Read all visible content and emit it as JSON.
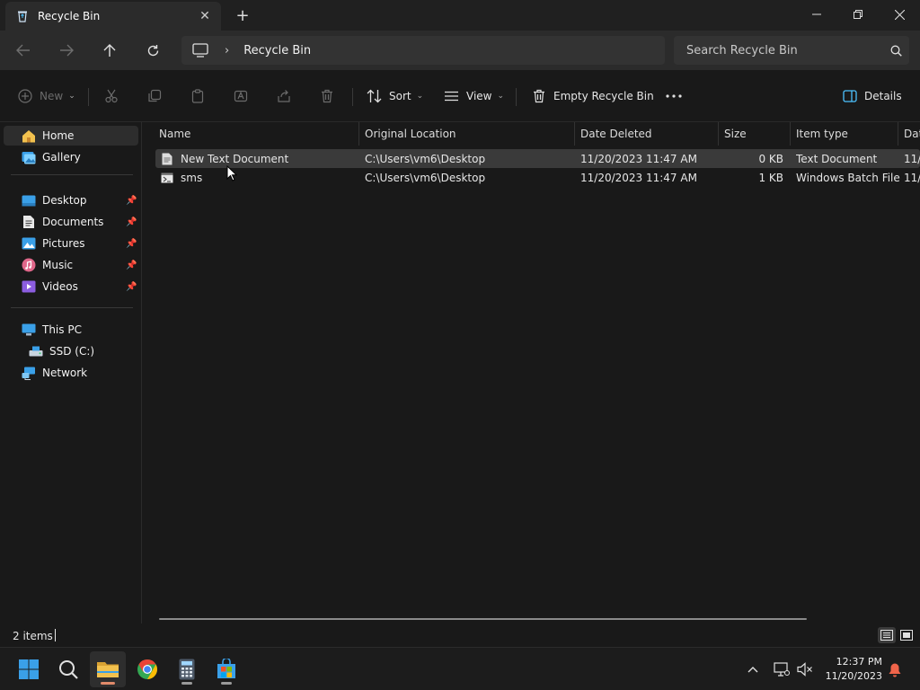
{
  "window": {
    "tab_title": "Recycle Bin",
    "close_tab": "✕",
    "new_tab": "+"
  },
  "address": {
    "crumbs": [
      "Recycle Bin"
    ],
    "search_placeholder": "Search Recycle Bin"
  },
  "toolbar": {
    "new_label": "New",
    "sort_label": "Sort",
    "view_label": "View",
    "empty_label": "Empty Recycle Bin",
    "details_label": "Details"
  },
  "sidebar": {
    "items": [
      {
        "label": "Home",
        "icon": "home-icon"
      },
      {
        "label": "Gallery",
        "icon": "gallery-icon"
      },
      {
        "label": "Desktop",
        "icon": "desktop-folder-icon"
      },
      {
        "label": "Documents",
        "icon": "documents-folder-icon"
      },
      {
        "label": "Pictures",
        "icon": "pictures-folder-icon"
      },
      {
        "label": "Music",
        "icon": "music-folder-icon"
      },
      {
        "label": "Videos",
        "icon": "videos-folder-icon"
      },
      {
        "label": "This PC",
        "icon": "this-pc-icon"
      },
      {
        "label": "SSD (C:)",
        "icon": "drive-icon"
      },
      {
        "label": "Network",
        "icon": "network-icon"
      }
    ]
  },
  "table": {
    "columns": [
      "Name",
      "Original Location",
      "Date Deleted",
      "Size",
      "Item type",
      "Dat"
    ],
    "rows": [
      {
        "name": "New Text Document",
        "location": "C:\\Users\\vm6\\Desktop",
        "date": "11/20/2023 11:47 AM",
        "size": "0 KB",
        "type": "Text Document",
        "extra": "11/"
      },
      {
        "name": "sms",
        "location": "C:\\Users\\vm6\\Desktop",
        "date": "11/20/2023 11:47 AM",
        "size": "1 KB",
        "type": "Windows Batch File",
        "extra": "11/"
      }
    ]
  },
  "status": {
    "item_count": "2 items"
  },
  "taskbar": {
    "time": "12:37 PM",
    "date": "11/20/2023"
  },
  "colors": {
    "accent": "#4cc2ff",
    "folder_yellow": "#f2c14e",
    "notification": "#f0644a"
  }
}
